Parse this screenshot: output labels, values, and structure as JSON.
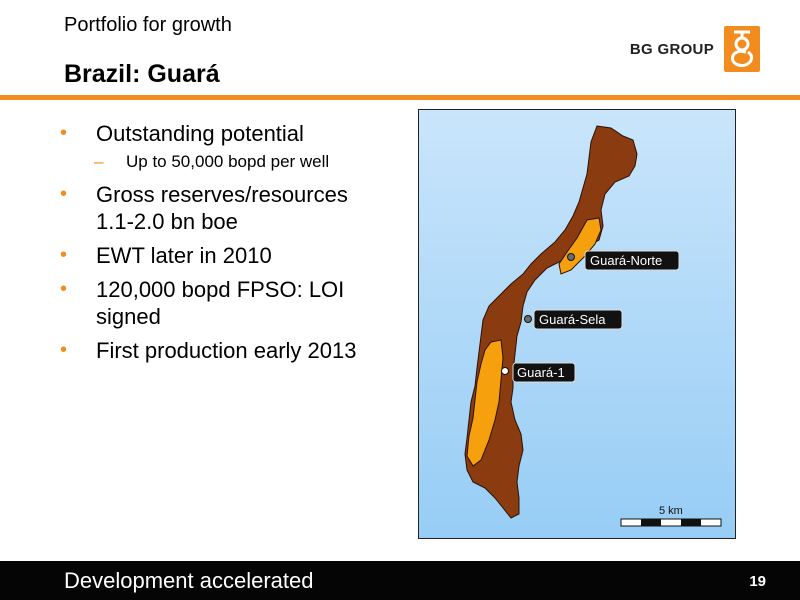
{
  "header": {
    "subtitle": "Portfolio for growth",
    "title": "Brazil: Guará",
    "brand": "BG GROUP"
  },
  "bullets": [
    {
      "level": 1,
      "text": "Outstanding potential"
    },
    {
      "level": 2,
      "text": "Up to 50,000 bopd per well"
    },
    {
      "level": 1,
      "text": "Gross reserves/resources 1.1-2.0 bn boe"
    },
    {
      "level": 1,
      "text": "EWT later in 2010"
    },
    {
      "level": 1,
      "text": "120,000 bopd FPSO: LOI signed"
    },
    {
      "level": 1,
      "text": "First production early 2013"
    }
  ],
  "map": {
    "wells": [
      "Guará-Norte",
      "Guará-Sela",
      "Guará-1"
    ],
    "scale_label": "5 km",
    "colors": {
      "sea": "#a9d6f7",
      "prospect": "#8a3b0f",
      "reservoir": "#f5a00c"
    }
  },
  "footer": {
    "text": "Development accelerated",
    "page": "19"
  },
  "colors": {
    "accent": "#f28c1e",
    "footer_bg": "#050505"
  }
}
